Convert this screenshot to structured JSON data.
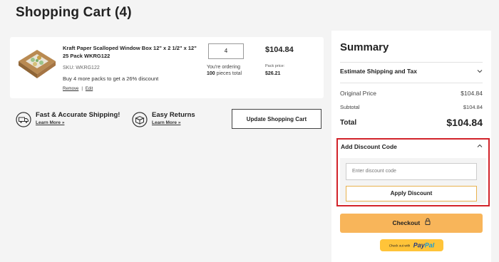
{
  "page": {
    "title": "Shopping Cart (4)"
  },
  "cart_item": {
    "title": "Kraft Paper Scalloped Window Box 12\" x 2 1/2\" x 12\" 25 Pack WKRG122",
    "sku": "SKU: WKRG122",
    "promo": "Buy 4 more packs to get a 26% discount",
    "remove_label": "Remove",
    "separator": "|",
    "edit_label": "Edit",
    "quantity": "4",
    "ordering_prefix": "You're ordering",
    "ordering_count": "100",
    "ordering_suffix": "pieces total",
    "price": "$104.84",
    "pack_price_label": "Pack price:",
    "pack_price": "$26.21"
  },
  "features": [
    {
      "title": "Fast & Accurate Shipping!",
      "link": "Learn More »",
      "icon": "truck-icon"
    },
    {
      "title": "Easy Returns",
      "link": "Learn More »",
      "icon": "return-box-icon"
    }
  ],
  "update_button": "Update Shopping Cart",
  "summary": {
    "title": "Summary",
    "shipping_label": "Estimate Shipping and Tax",
    "original_price_label": "Original Price",
    "original_price": "$104.84",
    "subtotal_label": "Subtotal",
    "subtotal": "$104.84",
    "total_label": "Total",
    "total": "$104.84"
  },
  "discount": {
    "header": "Add Discount Code",
    "placeholder": "Enter discount code",
    "apply_label": "Apply Discount"
  },
  "checkout": {
    "label": "Checkout"
  },
  "paypal": {
    "small": "Check out with",
    "brand_part1": "Pay",
    "brand_part2": "Pal"
  },
  "colors": {
    "accent": "#f8b55a",
    "highlight_border": "#d2232a",
    "paypal_yellow": "#ffc439"
  }
}
